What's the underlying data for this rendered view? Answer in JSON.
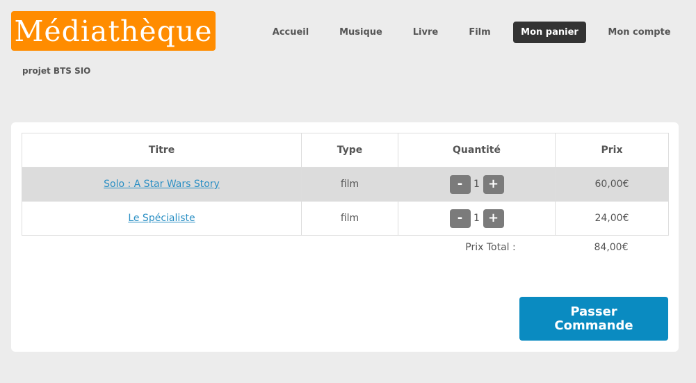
{
  "brand": {
    "logo_text": "Médiathèque",
    "tagline": "projet BTS SIO"
  },
  "nav": {
    "items": [
      {
        "label": "Accueil",
        "active": false
      },
      {
        "label": "Musique",
        "active": false
      },
      {
        "label": "Livre",
        "active": false
      },
      {
        "label": "Film",
        "active": false
      },
      {
        "label": "Mon panier",
        "active": true
      },
      {
        "label": "Mon compte",
        "active": false
      }
    ]
  },
  "cart": {
    "columns": [
      "Titre",
      "Type",
      "Quantité",
      "Prix"
    ],
    "rows": [
      {
        "title": "Solo : A Star Wars Story",
        "type": "film",
        "quantity": "1",
        "price": "60,00€"
      },
      {
        "title": "Le Spécialiste",
        "type": "film",
        "quantity": "1",
        "price": "24,00€"
      }
    ],
    "decrement_label": "-",
    "increment_label": "+",
    "total_label": "Prix Total :",
    "total_value": "84,00€"
  },
  "order_button_label": "Passer Commande",
  "colors": {
    "brand": "#ff8c00",
    "nav_active": "#333333",
    "link": "#2a8fc4",
    "order_button": "#0a8bc1"
  }
}
